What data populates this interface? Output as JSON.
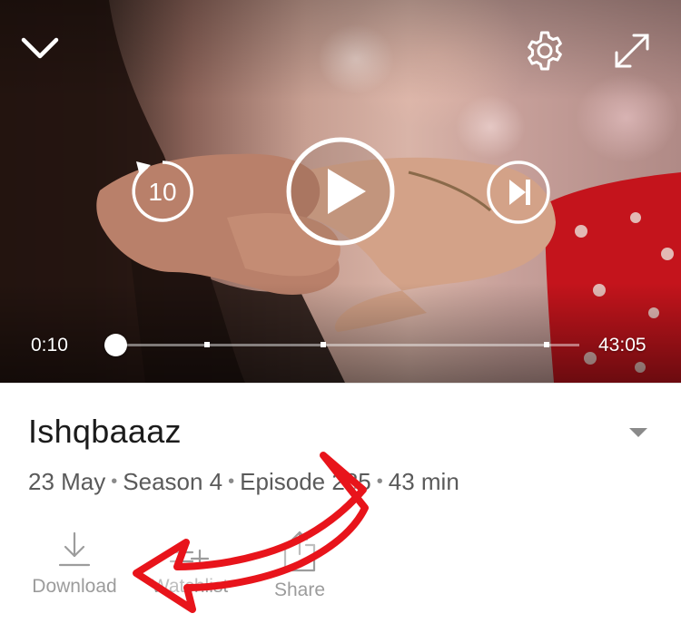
{
  "player": {
    "current_time": "0:10",
    "duration": "43:05",
    "progress": 0.004,
    "rewind_seconds": "10",
    "chapter_markers": [
      0.2,
      0.45,
      0.93
    ],
    "icons": {
      "collapse": "chevron-down-icon",
      "settings": "gear-icon",
      "fullscreen": "expand-icon",
      "rewind": "rewind-10-icon",
      "play": "play-icon",
      "next": "next-episode-icon"
    }
  },
  "show": {
    "title": "Ishqbaaaz",
    "date": "23 May",
    "season": "Season 4",
    "episode": "Episode 285",
    "runtime": "43 min"
  },
  "actions": [
    {
      "label": "Download",
      "icon": "download-icon"
    },
    {
      "label": "Watchlist",
      "icon": "add-to-list-icon"
    },
    {
      "label": "Share",
      "icon": "share-icon"
    }
  ],
  "annotation": {
    "arrow_color": "#e8141b",
    "arrow_target": "download-button"
  }
}
